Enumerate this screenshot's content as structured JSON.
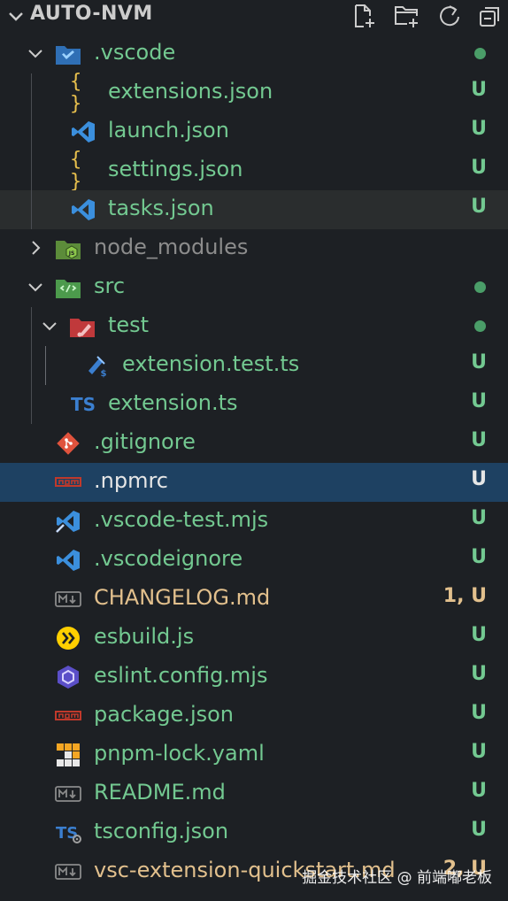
{
  "header": {
    "title": "AUTO-NVM",
    "actions": [
      "new-file-icon",
      "new-folder-icon",
      "refresh-icon",
      "collapse-all-icon"
    ]
  },
  "colors": {
    "background": "#1d2024",
    "untracked_green": "#73c991",
    "modified_yellow": "#e2c08d",
    "ignored_gray": "#8c8c8c",
    "selected_row": "#1e4162",
    "hover_row": "#2a2d2e"
  },
  "tree": {
    "vscode_folder": ".vscode",
    "extensions_json": "extensions.json",
    "launch_json": "launch.json",
    "settings_json": "settings.json",
    "tasks_json": "tasks.json",
    "node_modules": "node_modules",
    "src_folder": "src",
    "test_folder": "test",
    "extension_test_ts": "extension.test.ts",
    "extension_ts": "extension.ts",
    "gitignore": ".gitignore",
    "npmrc": ".npmrc",
    "vscode_test_mjs": ".vscode-test.mjs",
    "vscodeignore": ".vscodeignore",
    "changelog_md": "CHANGELOG.md",
    "esbuild_js": "esbuild.js",
    "eslint_config": "eslint.config.mjs",
    "package_json": "package.json",
    "pnpm_lock": "pnpm-lock.yaml",
    "readme_md": "README.md",
    "tsconfig_json": "tsconfig.json",
    "vsc_quickstart": "vsc-extension-quickstart.md"
  },
  "badges": {
    "untracked": "U",
    "changelog": "1, U",
    "quickstart": "2, U"
  },
  "watermark": "掘金技术社区 @ 前端嘟老板"
}
